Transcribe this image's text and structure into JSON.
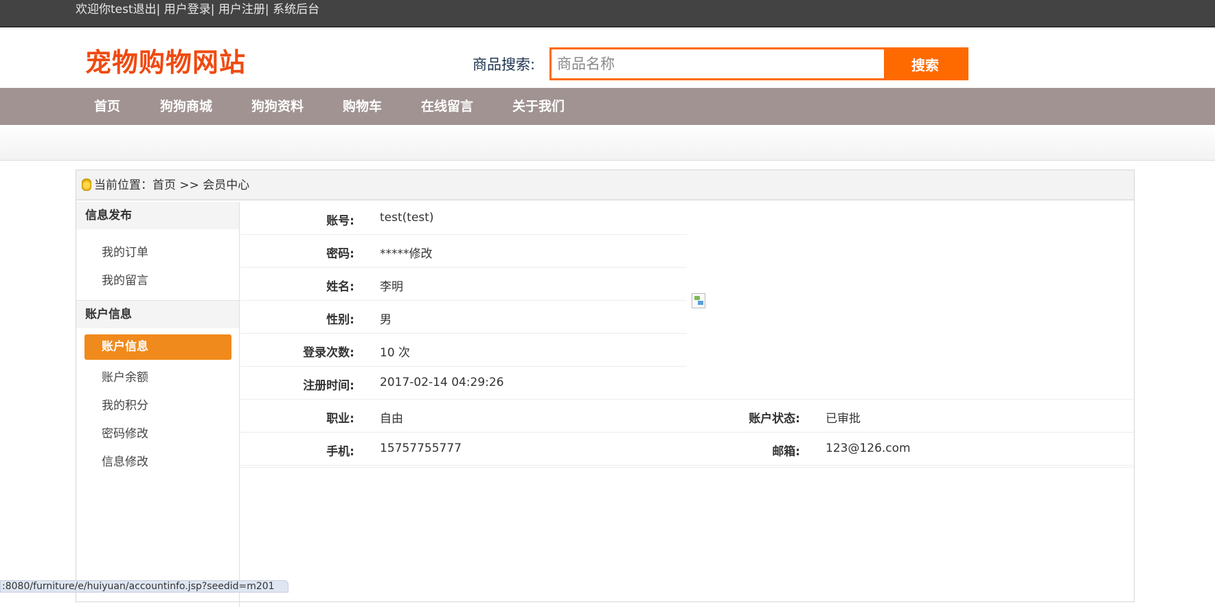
{
  "topbar": {
    "welcome": "欢迎你test",
    "logout": "退出|",
    "login": "用户登录|",
    "register": "用户注册|",
    "admin": "系统后台"
  },
  "header": {
    "logo": "宠物购物网站",
    "search_label": "商品搜索:",
    "search_placeholder": "商品名称",
    "search_button": "搜索"
  },
  "nav": {
    "items": [
      "首页",
      "狗狗商城",
      "狗狗资料",
      "购物车",
      "在线留言",
      "关于我们"
    ]
  },
  "breadcrumb": {
    "text": "当前位置：首页 >> 会员中心"
  },
  "sidebar": {
    "section1_title": "信息发布",
    "section1_items": [
      "我的订单",
      "我的留言"
    ],
    "section2_title": "账户信息",
    "active_item": "账户信息",
    "section2_items": [
      "账户余额",
      "我的积分",
      "密码修改",
      "信息修改"
    ]
  },
  "account": {
    "fields": [
      {
        "label": "账号:",
        "value": "test(test)"
      },
      {
        "label": "密码:",
        "value": "*****修改"
      },
      {
        "label": "姓名:",
        "value": "李明"
      },
      {
        "label": "性别:",
        "value": "男"
      },
      {
        "label": "登录次数:",
        "value": "10 次"
      },
      {
        "label": "注册时间:",
        "value": "2017-02-14 04:29:26"
      },
      {
        "label": "职业:",
        "value": "自由"
      },
      {
        "label": "手机:",
        "value": "15757755777"
      }
    ],
    "right_fields": [
      {
        "label": "账户状态:",
        "value": "已审批"
      },
      {
        "label": "邮箱:",
        "value": "123@126.com"
      }
    ]
  },
  "status_bar": {
    "url": ":8080/furniture/e/huiyuan/accountinfo.jsp?seedid=m201"
  },
  "colors": {
    "accent": "#ff6a00",
    "logo": "#ef4a11",
    "nav_bg": "#a09391",
    "active_side": "#f08a1c"
  }
}
